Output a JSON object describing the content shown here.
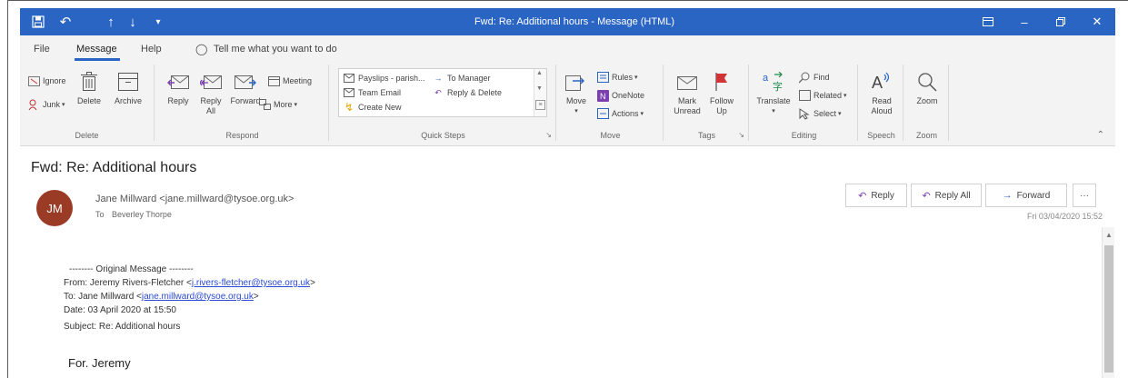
{
  "window": {
    "title": "Fwd: Re: Additional hours  -  Message (HTML)"
  },
  "menu": {
    "file": "File",
    "message": "Message",
    "help": "Help",
    "tell_me": "Tell me what you want to do"
  },
  "ribbon": {
    "delete_group": {
      "label": "Delete",
      "ignore": "Ignore",
      "junk": "Junk",
      "delete": "Delete",
      "archive": "Archive"
    },
    "respond_group": {
      "label": "Respond",
      "reply": "Reply",
      "reply_all_1": "Reply",
      "reply_all_2": "All",
      "forward": "Forward",
      "meeting": "Meeting",
      "more": "More"
    },
    "quick_steps_group": {
      "label": "Quick Steps",
      "payslips": "Payslips - parish...",
      "team_email": "Team Email",
      "create_new": "Create New",
      "to_manager": "To Manager",
      "reply_delete": "Reply & Delete"
    },
    "move_group": {
      "label": "Move",
      "move": "Move",
      "rules": "Rules",
      "onenote": "OneNote",
      "actions": "Actions"
    },
    "tags_group": {
      "label": "Tags",
      "mark_unread_1": "Mark",
      "mark_unread_2": "Unread",
      "follow_up_1": "Follow",
      "follow_up_2": "Up"
    },
    "editing_group": {
      "label": "Editing",
      "translate": "Translate",
      "find": "Find",
      "related": "Related",
      "select": "Select"
    },
    "speech_group": {
      "label": "Speech",
      "read_aloud_1": "Read",
      "read_aloud_2": "Aloud"
    },
    "zoom_group": {
      "label": "Zoom",
      "zoom": "Zoom"
    }
  },
  "message": {
    "subject": "Fwd: Re: Additional hours",
    "avatar_initials": "JM",
    "sender": "Jane Millward <jane.millward@tysoe.org.uk>",
    "to_prefix": "To",
    "to_name": "Beverley Thorpe",
    "date": "Fri 03/04/2020 15:52",
    "actions": {
      "reply": "Reply",
      "reply_all": "Reply All",
      "forward": "Forward",
      "more": "···"
    }
  },
  "body": {
    "original_header": "-------- Original Message --------",
    "from_label": "From: Jeremy Rivers-Fletcher <",
    "from_email": "j.rivers-fletcher@tysoe.org.uk",
    "from_close": ">",
    "to_label": "To: Jane Millward <",
    "to_email": "jane.millward@tysoe.org.uk",
    "to_close": ">",
    "date_line": "Date: 03 April 2020 at 15:50",
    "subject_line": "Subject: Re: Additional hours",
    "greeting": "For. Jeremy"
  },
  "colors": {
    "title_bar": "#2b65c4",
    "avatar": "#9a3b26",
    "link": "#2b4bd6"
  }
}
